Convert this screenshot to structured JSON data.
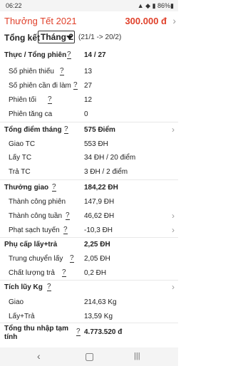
{
  "status": {
    "time": "06:22",
    "icons": "▲ ◆ ▮ 86%▮"
  },
  "header": {
    "title": "Thưởng Tết 2021",
    "amount": "300.000 đ",
    "chevron": "›"
  },
  "summary": {
    "label": "Tổng kết",
    "month": "Tháng 2",
    "range": "(21/1 -> 20/2)"
  },
  "rows": [
    {
      "k": "Thực / Tổng phiên",
      "q": "?",
      "v": "14 / 27"
    },
    {
      "k": "Số phiên thiếu",
      "q": "?",
      "v": "13"
    },
    {
      "k": "Số phiên cần đi làm",
      "q": "?",
      "v": "27"
    },
    {
      "k": "Phiên tối",
      "q": "?",
      "v": "12"
    },
    {
      "k": "Phiên tăng ca",
      "q": "",
      "v": "0"
    },
    {
      "k": "Tổng điểm tháng",
      "q": "?",
      "v": "575 Điểm"
    },
    {
      "k": "Giao TC",
      "q": "",
      "v": "553 ĐH"
    },
    {
      "k": "Lấy TC",
      "q": "",
      "v": "34 ĐH / 20 điểm"
    },
    {
      "k": "Trả TC",
      "q": "",
      "v": "3 ĐH / 2 điểm"
    },
    {
      "k": "Thưởng giao",
      "q": "?",
      "v": "184,22 ĐH"
    },
    {
      "k": "Thành công phiên",
      "q": "",
      "v": "147,9 ĐH"
    },
    {
      "k": "Thành công tuần",
      "q": "?",
      "v": "46,62 ĐH"
    },
    {
      "k": "Phạt sạch tuyến",
      "q": "?",
      "v": "-10,3 ĐH"
    },
    {
      "k": "Phụ cấp lấy+trả",
      "q": "",
      "v": "2,25 ĐH"
    },
    {
      "k": "Trung chuyển lấy",
      "q": "?",
      "v": "2,05 ĐH"
    },
    {
      "k": "Chất lượng trả",
      "q": "?",
      "v": "0,2 ĐH"
    },
    {
      "k": "Tích lũy Kg",
      "q": "?",
      "v": ""
    },
    {
      "k": "Giao",
      "q": "",
      "v": "214,63 Kg"
    },
    {
      "k": "Lấy+Trả",
      "q": "",
      "v": "13,59 Kg"
    },
    {
      "k": "Tổng thu nhập tạm tính",
      "q": "?",
      "v": "4.773.520 đ"
    }
  ],
  "chevron": "›",
  "nav": {
    "back": "‹",
    "home": "▢",
    "recents": "|||"
  }
}
